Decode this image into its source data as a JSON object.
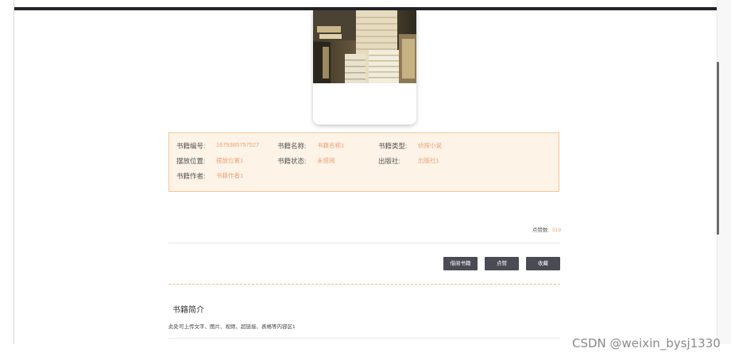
{
  "book": {
    "fields": [
      {
        "key": "id",
        "label": "书籍编号:",
        "value": "1679385757527"
      },
      {
        "key": "name",
        "label": "书籍名称:",
        "value": "书籍名称1"
      },
      {
        "key": "type",
        "label": "书籍类型:",
        "value": "侦探小说"
      },
      {
        "key": "location",
        "label": "摆放位置:",
        "value": "摆放位置1"
      },
      {
        "key": "status",
        "label": "书籍状态:",
        "value": "未借阅"
      },
      {
        "key": "publisher",
        "label": "出版社:",
        "value": "出版社1"
      },
      {
        "key": "author",
        "label": "书籍作者:",
        "value": "书籍作者1"
      }
    ],
    "likes": {
      "label": "点赞数:",
      "value": "519"
    }
  },
  "actions": {
    "borrow_label": "借阅书籍",
    "like_label": "点赞",
    "favorite_label": "收藏"
  },
  "intro": {
    "title": "书籍简介",
    "text": "此处可上传文字、图片、视频、超链接、表格等内容区1"
  },
  "watermark": "CSDN @weixin_bysj1330",
  "colors": {
    "accent_value": "#e9a27a",
    "info_bg": "#fdf3e6",
    "info_border": "#f1c79a",
    "button_bg": "#4b4b55",
    "top_bar": "#23232b"
  }
}
